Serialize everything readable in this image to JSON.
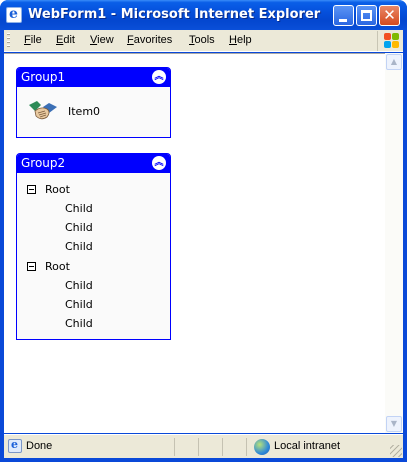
{
  "window": {
    "title": "WebForm1 - Microsoft Internet Explorer"
  },
  "menubar": {
    "items": [
      {
        "label": "File",
        "mnemonic": "F",
        "rest": "ile"
      },
      {
        "label": "Edit",
        "mnemonic": "E",
        "rest": "dit"
      },
      {
        "label": "View",
        "mnemonic": "V",
        "rest": "iew"
      },
      {
        "label": "Favorites",
        "mnemonic": "F",
        "rest": "avorites"
      },
      {
        "label": "Tools",
        "mnemonic": "T",
        "rest": "ools"
      },
      {
        "label": "Help",
        "mnemonic": "H",
        "rest": "elp"
      }
    ]
  },
  "groups": [
    {
      "title": "Group1",
      "items": [
        {
          "label": "Item0",
          "icon": "handshake-icon"
        }
      ]
    },
    {
      "title": "Group2",
      "tree": [
        {
          "label": "Root",
          "children": [
            "Child",
            "Child",
            "Child"
          ]
        },
        {
          "label": "Root",
          "children": [
            "Child",
            "Child",
            "Child"
          ]
        }
      ]
    }
  ],
  "statusbar": {
    "status": "Done",
    "zone": "Local intranet"
  },
  "colors": {
    "group_header": "#0000ff",
    "title_bar": "#0550dc",
    "chrome": "#ece9d8"
  }
}
